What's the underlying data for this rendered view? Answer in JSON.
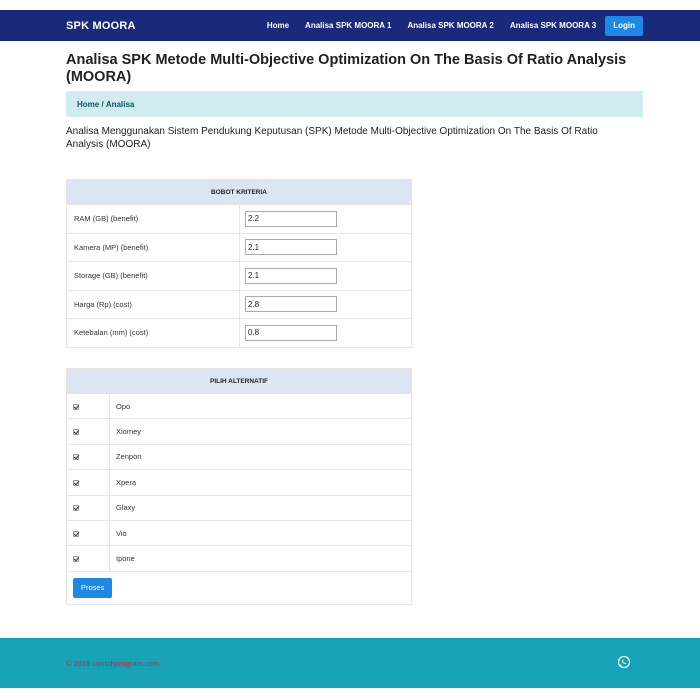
{
  "navbar": {
    "brand": "SPK MOORA",
    "links": [
      "Home",
      "Analisa SPK MOORA 1",
      "Analisa SPK MOORA 2",
      "Analisa SPK MOORA 3"
    ],
    "login": "Login",
    "color": "#1a2a7a"
  },
  "page": {
    "title": "Analisa SPK Metode Multi-Objective Optimization On The Basis Of Ratio Analysis (MOORA)",
    "breadcrumb": {
      "home": "Home",
      "separator": " / ",
      "current": "Analisa"
    },
    "subtitle": "Analisa Menggunakan Sistem Pendukung Keputusan (SPK) Metode Multi-Objective Optimization On The Basis Of Ratio Analysis (MOORA)"
  },
  "bobot": {
    "header": "BOBOT KRITERIA",
    "rows": [
      {
        "label": "RAM (GB) (benefit)",
        "value": "2.2"
      },
      {
        "label": "Kamera (MP) (benefit)",
        "value": "2.1"
      },
      {
        "label": "Storage (GB) (benefit)",
        "value": "2.1"
      },
      {
        "label": "Harga (Rp) (cost)",
        "value": "2.8"
      },
      {
        "label": "Ketebalan (mm) (cost)",
        "value": "0.8"
      }
    ]
  },
  "alternatif": {
    "header": "PILIH ALTERNATIF",
    "items": [
      {
        "name": "Opo",
        "checked": true
      },
      {
        "name": "Xiomey",
        "checked": true
      },
      {
        "name": "Zenpon",
        "checked": true
      },
      {
        "name": "Xpera",
        "checked": true
      },
      {
        "name": "Glaxy",
        "checked": true
      },
      {
        "name": "Vio",
        "checked": true
      },
      {
        "name": "Ipone",
        "checked": true
      }
    ],
    "submit": "Proses"
  },
  "footer": {
    "copyright": "© 2018 contohprogram.com",
    "icon": "whatsapp-icon",
    "color": "#17a2b8"
  }
}
